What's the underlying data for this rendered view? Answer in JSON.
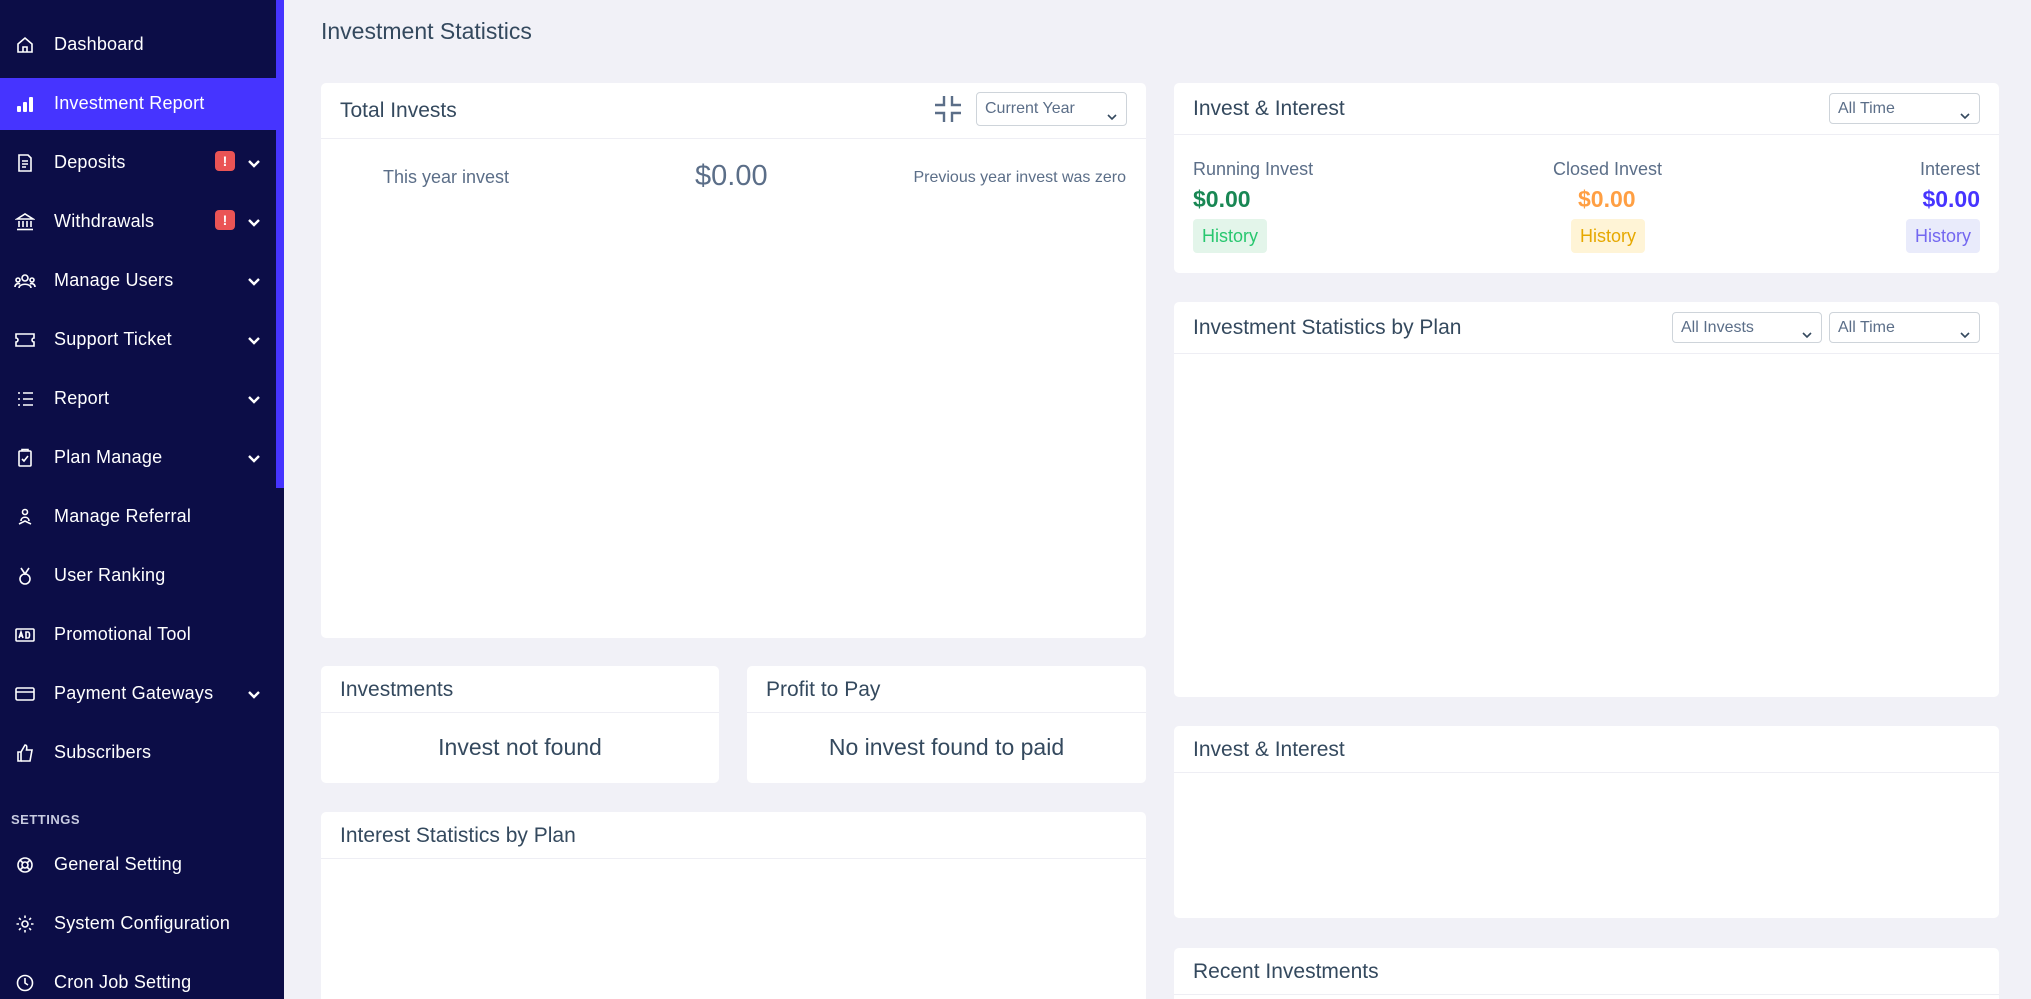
{
  "sidebar": {
    "items": [
      {
        "label": "Dashboard",
        "icon": "home-icon"
      },
      {
        "label": "Investment Report",
        "icon": "bar-chart-icon",
        "active": true
      },
      {
        "label": "Deposits",
        "icon": "bill-icon",
        "badge": "!",
        "dropdown": true
      },
      {
        "label": "Withdrawals",
        "icon": "bank-icon",
        "badge": "!",
        "dropdown": true
      },
      {
        "label": "Manage Users",
        "icon": "users-icon",
        "dropdown": true
      },
      {
        "label": "Support Ticket",
        "icon": "ticket-icon",
        "dropdown": true
      },
      {
        "label": "Report",
        "icon": "list-icon",
        "dropdown": true
      },
      {
        "label": "Plan Manage",
        "icon": "clipboard-check-icon",
        "dropdown": true
      },
      {
        "label": "Manage Referral",
        "icon": "referral-icon"
      },
      {
        "label": "User Ranking",
        "icon": "medal-icon"
      },
      {
        "label": "Promotional Tool",
        "icon": "ad-icon"
      },
      {
        "label": "Payment Gateways",
        "icon": "credit-card-icon",
        "dropdown": true
      },
      {
        "label": "Subscribers",
        "icon": "thumbs-up-icon"
      }
    ],
    "settings_heading": "SETTINGS",
    "settings_items": [
      {
        "label": "General Setting",
        "icon": "lifebuoy-icon"
      },
      {
        "label": "System Configuration",
        "icon": "gear-icon"
      },
      {
        "label": "Cron Job Setting",
        "icon": "clock-icon"
      }
    ],
    "active_color": "#4634ff",
    "background_color": "#0c0d47"
  },
  "page": {
    "title": "Investment Statistics"
  },
  "total_invests": {
    "title": "Total Invests",
    "period_select": "Current Year",
    "this_year_label": "This year invest",
    "amount": "$0.00",
    "previous_note": "Previous year invest was zero"
  },
  "invest_interest_top": {
    "title": "Invest & Interest",
    "period_select": "All Time",
    "stats": [
      {
        "label": "Running Invest",
        "value": "$0.00",
        "history": "History",
        "color": "#198754"
      },
      {
        "label": "Closed Invest",
        "value": "$0.00",
        "history": "History",
        "color": "#ff9f43"
      },
      {
        "label": "Interest",
        "value": "$0.00",
        "history": "History",
        "color": "#4634ff"
      }
    ]
  },
  "stats_by_plan": {
    "title": "Investment Statistics by Plan",
    "type_select": "All Invests",
    "period_select": "All Time"
  },
  "investments": {
    "title": "Investments",
    "empty": "Invest not found"
  },
  "profit_to_pay": {
    "title": "Profit to Pay",
    "empty": "No invest found to paid"
  },
  "invest_interest_bottom": {
    "title": "Invest & Interest"
  },
  "interest_by_plan": {
    "title": "Interest Statistics by Plan"
  },
  "recent_investments": {
    "title": "Recent Investments"
  }
}
